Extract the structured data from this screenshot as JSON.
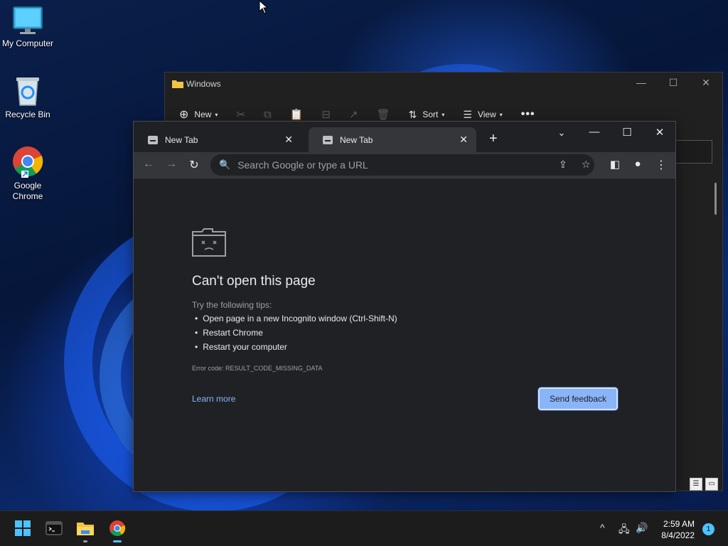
{
  "desktop": {
    "icons": [
      {
        "label": "My Computer",
        "icon": "monitor-icon"
      },
      {
        "label": "Recycle Bin",
        "icon": "recycle-bin-icon"
      },
      {
        "label": "Google\nChrome",
        "label_line1": "Google",
        "label_line2": "Chrome",
        "icon": "chrome-icon"
      }
    ]
  },
  "explorer": {
    "title": "Windows",
    "commands": {
      "new": "New",
      "sort": "Sort",
      "view": "View"
    }
  },
  "chrome": {
    "tabs": [
      {
        "title": "New Tab",
        "active": false
      },
      {
        "title": "New Tab",
        "active": true
      }
    ],
    "omnibox_placeholder": "Search Google or type a URL",
    "error": {
      "title": "Can't open this page",
      "tips_intro": "Try the following tips:",
      "tips": [
        "Open page in a new Incognito window (Ctrl-Shift-N)",
        "Restart Chrome",
        "Restart your computer"
      ],
      "code": "Error code: RESULT_CODE_MISSING_DATA",
      "learn_more": "Learn more",
      "feedback_button": "Send feedback"
    }
  },
  "taskbar": {
    "time": "2:59 AM",
    "date": "8/4/2022",
    "notification_count": "1"
  },
  "colors": {
    "accent": "#8ab4f8",
    "chrome_bg": "#202124",
    "chrome_toolbar": "#35363a",
    "taskbar_indicator": "#4cc2ff"
  }
}
